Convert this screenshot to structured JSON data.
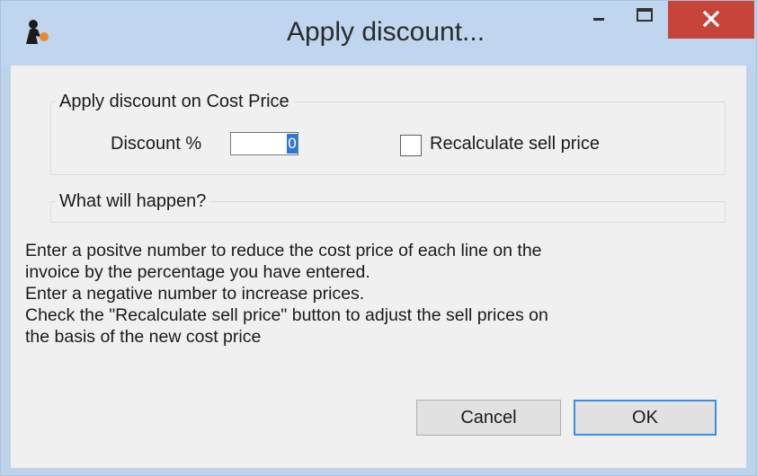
{
  "window": {
    "title": "Apply discount...",
    "controls": {
      "minimize_icon": "minimize-icon",
      "maximize_icon": "maximize-icon",
      "close_icon": "close-icon"
    },
    "accent_color": "#c7443a"
  },
  "discount_group": {
    "legend": "Apply discount on Cost Price",
    "discount_label": "Discount %",
    "discount_value": "0",
    "recalculate_label": "Recalculate sell price",
    "recalculate_checked": false
  },
  "info_group": {
    "legend": "What will happen?"
  },
  "description": {
    "lines": [
      "Enter a positve number to reduce the cost price of each line on the",
      "invoice by the percentage you have entered.",
      "Enter a negative number to increase prices.",
      "Check the \"Recalculate sell price\" button to adjust the sell prices on",
      "the basis of the new cost price"
    ]
  },
  "buttons": {
    "cancel": "Cancel",
    "ok": "OK"
  }
}
